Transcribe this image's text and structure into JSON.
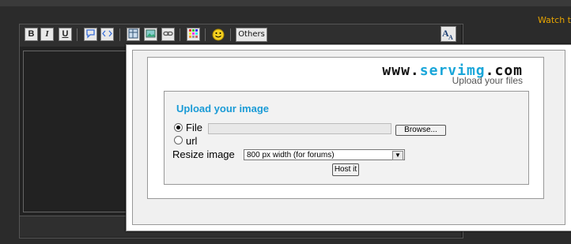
{
  "header": {
    "watch_text": "Watch t"
  },
  "toolbar": {
    "bold": "B",
    "italic": "I",
    "underline": "U",
    "others_label": "Others"
  },
  "upload_dialog": {
    "logo_part1": "www.",
    "logo_part2": "servimg",
    "logo_part3": ".com",
    "tagline": "Upload your files",
    "title": "Upload your image",
    "file_label": "File",
    "url_label": "url",
    "browse_label": "Browse...",
    "resize_label": "Resize image",
    "resize_selected": "800 px width (for forums)",
    "host_label": "Host it",
    "selected_source": "File"
  },
  "colors": {
    "accent": "#1a9bd6",
    "watch": "#e8a500"
  }
}
